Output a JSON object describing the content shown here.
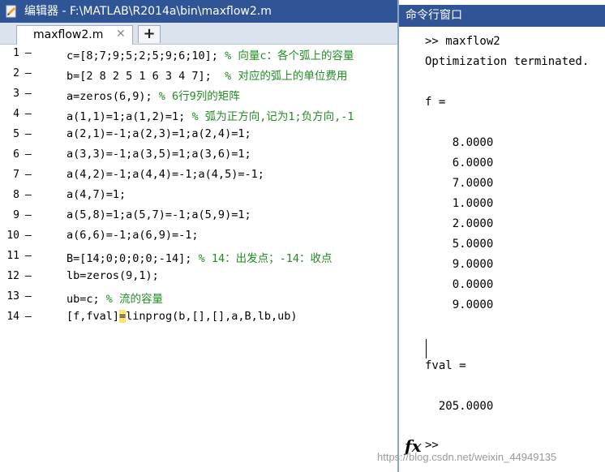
{
  "editor": {
    "title": "编辑器 - F:\\MATLAB\\R2014a\\bin\\maxflow2.m",
    "tab_label": "maxflow2.m",
    "tab_close": "✕",
    "add_tab": "+",
    "lines": [
      {
        "num": "1",
        "code": "c=[8;7;9;5;2;5;9;6;10]; ",
        "comment": "% 向量c：各个弧上的容量"
      },
      {
        "num": "2",
        "code": "b=[2 8 2 5 1 6 3 4 7];  ",
        "comment": "% 对应的弧上的单位费用"
      },
      {
        "num": "3",
        "code": "a=zeros(6,9); ",
        "comment": "% 6行9列的矩阵"
      },
      {
        "num": "4",
        "code": "a(1,1)=1;a(1,2)=1; ",
        "comment": "% 弧为正方向,记为1;负方向,-1"
      },
      {
        "num": "5",
        "code": "a(2,1)=-1;a(2,3)=1;a(2,4)=1;",
        "comment": ""
      },
      {
        "num": "6",
        "code": "a(3,3)=-1;a(3,5)=1;a(3,6)=1;",
        "comment": ""
      },
      {
        "num": "7",
        "code": "a(4,2)=-1;a(4,4)=-1;a(4,5)=-1;",
        "comment": ""
      },
      {
        "num": "8",
        "code": "a(4,7)=1;",
        "comment": ""
      },
      {
        "num": "9",
        "code": "a(5,8)=1;a(5,7)=-1;a(5,9)=1;",
        "comment": ""
      },
      {
        "num": "10",
        "code": "a(6,6)=-1;a(6,9)=-1;",
        "comment": ""
      },
      {
        "num": "11",
        "code": "B=[14;0;0;0;0;-14]; ",
        "comment": "% 14：出发点；-14：收点"
      },
      {
        "num": "12",
        "code": "lb=zeros(9,1);",
        "comment": ""
      },
      {
        "num": "13",
        "code": "ub=c; ",
        "comment": "% 流的容量"
      }
    ],
    "last_line": {
      "num": "14",
      "before": "[f,fval]",
      "highlight": "=",
      "after": "linprog(b,[],[],a,B,lb,ub)"
    }
  },
  "command_window": {
    "title": "命令行窗口",
    "output_lines": [
      ">> maxflow2",
      "Optimization terminated.",
      "",
      "f =",
      "",
      "    8.0000",
      "    6.0000",
      "    7.0000",
      "    1.0000",
      "    2.0000",
      "    5.0000",
      "    9.0000",
      "    0.0000",
      "    9.0000",
      "",
      "",
      "fval =",
      "",
      "  205.0000"
    ],
    "fx_label": "fx",
    "prompt": ">>"
  },
  "watermark": "https://blog.csdn.net/weixin_44949135"
}
